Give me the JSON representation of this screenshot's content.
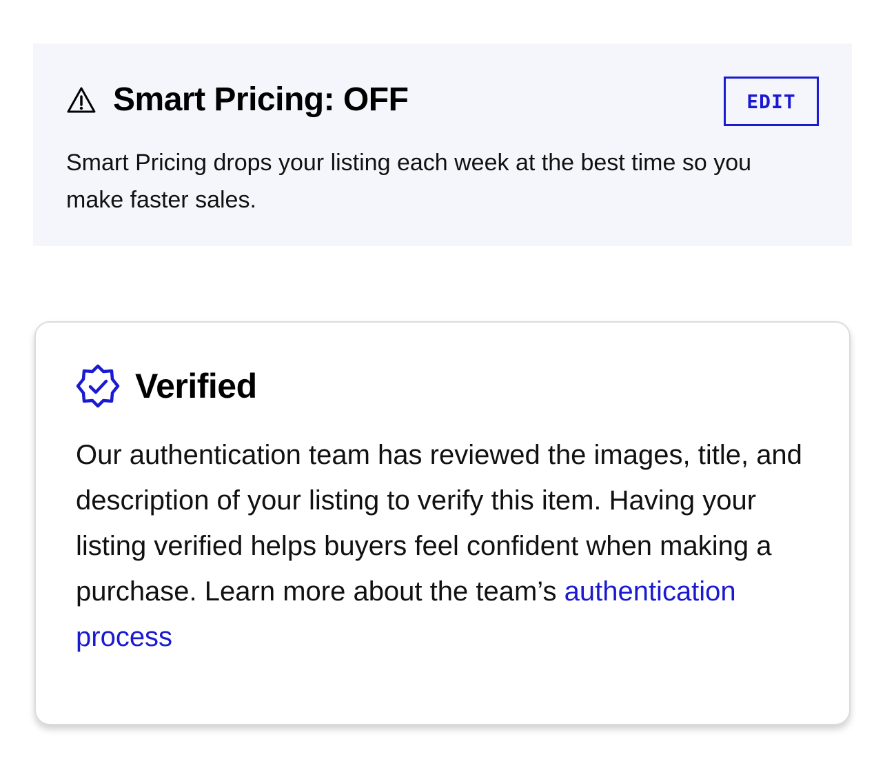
{
  "smart_pricing": {
    "icon": "warning-triangle-icon",
    "title": "Smart Pricing: OFF",
    "edit_label": "EDIT",
    "description": "Smart Pricing drops your listing each week at the best time so you make faster sales.",
    "background_color": "#f5f6fc",
    "accent_color": "#1a1ad1"
  },
  "verified": {
    "icon": "verified-badge-icon",
    "title": "Verified",
    "body_text": "Our authentication team has reviewed the images, title, and description of your listing to verify this item. Having your listing verified helps buyers feel confident when making a purchase. Learn more about the team’s",
    "link_text": "authentication process",
    "accent_color": "#1a1ad1"
  }
}
